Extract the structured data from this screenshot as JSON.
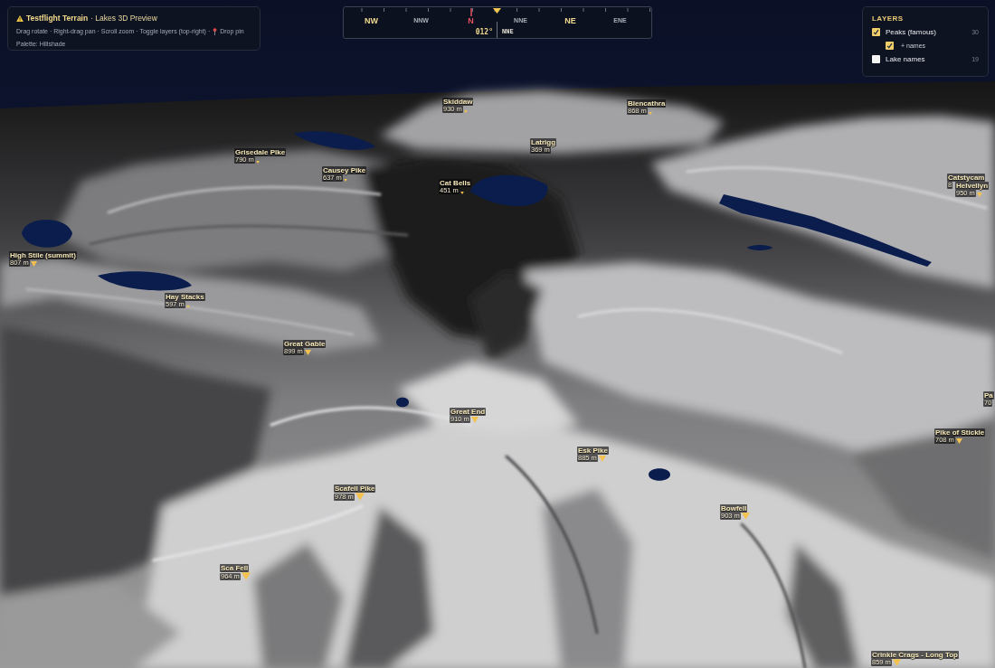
{
  "header": {
    "title": "Testflight Terrain",
    "subtitle": "· Lakes 3D Preview",
    "hint": "Drag rotate · Right-drag pan · Scroll zoom · Toggle layers (top-right) ·",
    "pin_action": "Drop pin",
    "palette": "Palette: Hillshade"
  },
  "compass": {
    "points": [
      {
        "label": "NW",
        "kind": "intercardinal"
      },
      {
        "label": "NNW",
        "kind": "minor"
      },
      {
        "label": "N",
        "kind": "cardinal"
      },
      {
        "label": "NNE",
        "kind": "minor"
      },
      {
        "label": "NE",
        "kind": "intercardinal"
      },
      {
        "label": "ENE",
        "kind": "minor"
      }
    ],
    "heading": "012°",
    "heading_point": "NNE"
  },
  "layers": {
    "title": "LAYERS",
    "items": [
      {
        "label": "Peaks (famous)",
        "checked": true,
        "count": "30",
        "children": [
          {
            "label": "+ names",
            "checked": true
          }
        ]
      },
      {
        "label": "Lake names",
        "checked": false,
        "count": "19"
      }
    ]
  },
  "peaks": [
    {
      "name": "Skiddaw",
      "elevation": "930 m"
    },
    {
      "name": "Blencathra",
      "elevation": "868 m"
    },
    {
      "name": "Latrigg",
      "elevation": "369 m"
    },
    {
      "name": "Grisedale Pike",
      "elevation": "790 m"
    },
    {
      "name": "Causey Pike",
      "elevation": "637 m"
    },
    {
      "name": "Catstycam",
      "elevation": "8"
    },
    {
      "name": "Cat Bells",
      "elevation": "451 m"
    },
    {
      "name": "Helvellyn",
      "elevation": "950 m"
    },
    {
      "name": "High Stile (summit)",
      "elevation": "807 m"
    },
    {
      "name": "Hay Stacks",
      "elevation": "597 m"
    },
    {
      "name": "Great Gable",
      "elevation": "899 m"
    },
    {
      "name": "Pa",
      "elevation": "70"
    },
    {
      "name": "Great End",
      "elevation": "910 m"
    },
    {
      "name": "Pike of Stickle",
      "elevation": "708 m"
    },
    {
      "name": "Esk Pike",
      "elevation": "885 m"
    },
    {
      "name": "Scafell Pike",
      "elevation": "978 m"
    },
    {
      "name": "Bowfell",
      "elevation": "903 m"
    },
    {
      "name": "Sca Fell",
      "elevation": "964 m"
    },
    {
      "name": "Crinkle Crags - Long Top",
      "elevation": "859 m"
    }
  ]
}
